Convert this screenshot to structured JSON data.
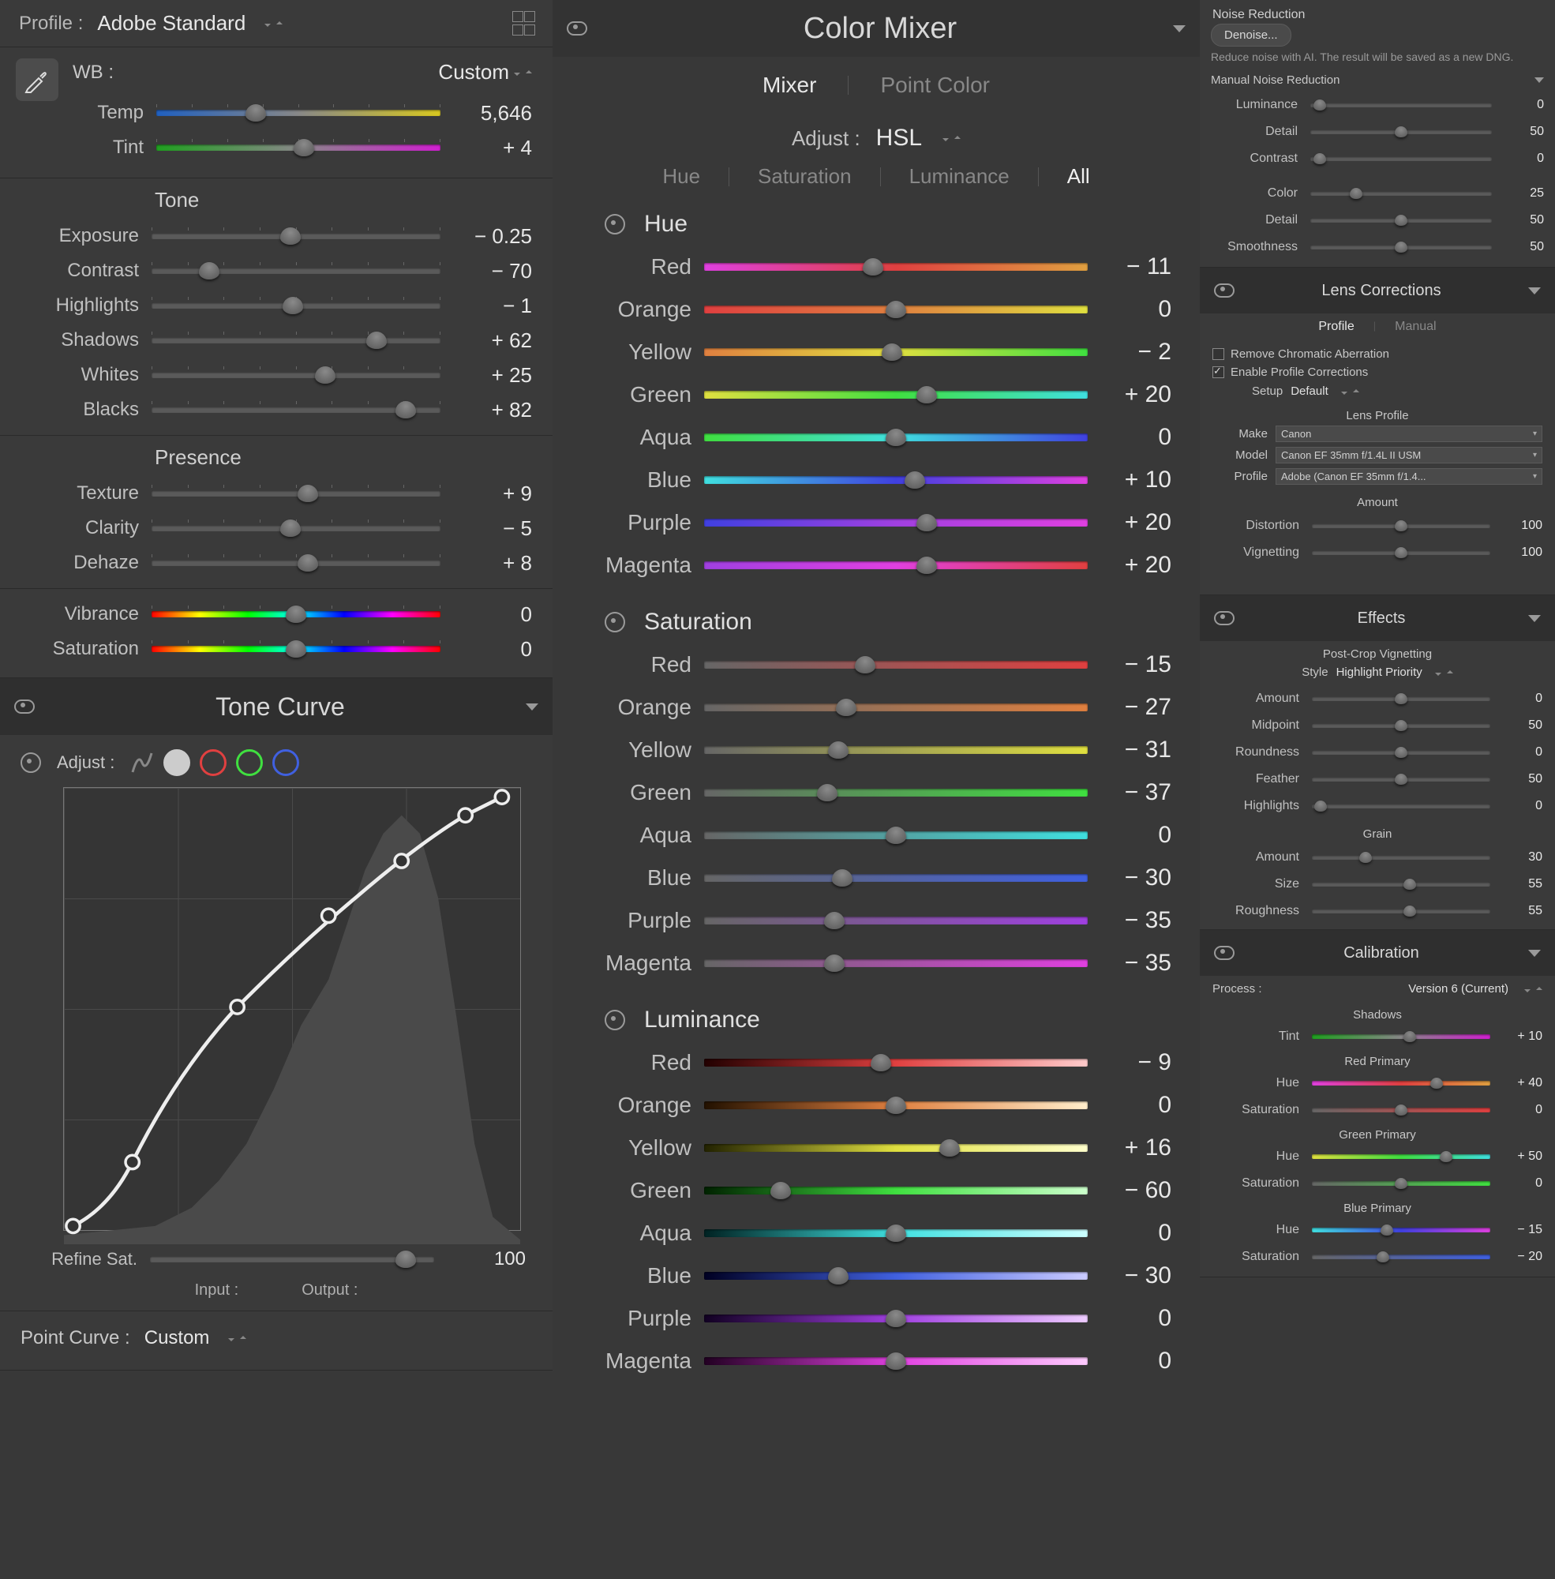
{
  "profile": {
    "label": "Profile :",
    "value": "Adobe Standard"
  },
  "basic": {
    "wb_label": "WB :",
    "wb_value": "Custom",
    "temp": {
      "label": "Temp",
      "value": "5,646",
      "pos": 35
    },
    "tint": {
      "label": "Tint",
      "value": "+ 4",
      "pos": 52
    },
    "tone_hdr": "Tone",
    "exposure": {
      "label": "Exposure",
      "value": "− 0.25",
      "pos": 48
    },
    "contrast": {
      "label": "Contrast",
      "value": "− 70",
      "pos": 20
    },
    "highlights": {
      "label": "Highlights",
      "value": "− 1",
      "pos": 49
    },
    "shadows": {
      "label": "Shadows",
      "value": "+ 62",
      "pos": 78
    },
    "whites": {
      "label": "Whites",
      "value": "+ 25",
      "pos": 60
    },
    "blacks": {
      "label": "Blacks",
      "value": "+ 82",
      "pos": 88
    },
    "presence_hdr": "Presence",
    "texture": {
      "label": "Texture",
      "value": "+ 9",
      "pos": 54
    },
    "clarity": {
      "label": "Clarity",
      "value": "− 5",
      "pos": 48
    },
    "dehaze": {
      "label": "Dehaze",
      "value": "+ 8",
      "pos": 54
    },
    "vibrance": {
      "label": "Vibrance",
      "value": "0",
      "pos": 50
    },
    "saturation": {
      "label": "Saturation",
      "value": "0",
      "pos": 50
    }
  },
  "tone_curve": {
    "title": "Tone Curve",
    "adjust": "Adjust :",
    "refine": {
      "label": "Refine Sat.",
      "value": "100",
      "pos": 90
    },
    "input": "Input :",
    "output": "Output :",
    "point_curve": "Point Curve :",
    "point_value": "Custom"
  },
  "color_mixer": {
    "title": "Color Mixer",
    "tab_mixer": "Mixer",
    "tab_point": "Point Color",
    "adjust": "Adjust :",
    "adjust_val": "HSL",
    "t_hue": "Hue",
    "t_sat": "Saturation",
    "t_lum": "Luminance",
    "t_all": "All",
    "colors": [
      "Red",
      "Orange",
      "Yellow",
      "Green",
      "Aqua",
      "Blue",
      "Purple",
      "Magenta"
    ],
    "hue": {
      "hdr": "Hue",
      "vals": [
        "− 11",
        "0",
        "− 2",
        "+ 20",
        "0",
        "+ 10",
        "+ 20",
        "+ 20"
      ],
      "pos": [
        44,
        50,
        49,
        58,
        50,
        55,
        58,
        58
      ]
    },
    "sat": {
      "hdr": "Saturation",
      "vals": [
        "− 15",
        "− 27",
        "− 31",
        "− 37",
        "0",
        "− 30",
        "− 35",
        "− 35"
      ],
      "pos": [
        42,
        37,
        35,
        32,
        50,
        36,
        34,
        34
      ]
    },
    "lum": {
      "hdr": "Luminance",
      "vals": [
        "− 9",
        "0",
        "+ 16",
        "− 60",
        "0",
        "− 30",
        "0",
        "0"
      ],
      "pos": [
        46,
        50,
        64,
        20,
        50,
        35,
        50,
        50
      ]
    }
  },
  "noise": {
    "title": "Noise Reduction",
    "btn": "Denoise...",
    "note": "Reduce noise with AI. The result will be saved as a new DNG.",
    "manual": "Manual Noise Reduction",
    "luminance": {
      "label": "Luminance",
      "value": "0",
      "pos": 5
    },
    "detail": {
      "label": "Detail",
      "value": "50",
      "pos": 50
    },
    "contrast": {
      "label": "Contrast",
      "value": "0",
      "pos": 5
    },
    "color": {
      "label": "Color",
      "value": "25",
      "pos": 25
    },
    "detail2": {
      "label": "Detail",
      "value": "50",
      "pos": 50
    },
    "smooth": {
      "label": "Smoothness",
      "value": "50",
      "pos": 50
    }
  },
  "lens": {
    "title": "Lens Corrections",
    "tab_profile": "Profile",
    "tab_manual": "Manual",
    "chk_ca": "Remove Chromatic Aberration",
    "chk_pc": "Enable Profile Corrections",
    "setup_lbl": "Setup",
    "setup_val": "Default",
    "profile_hdr": "Lens Profile",
    "make_lbl": "Make",
    "make_val": "Canon",
    "model_lbl": "Model",
    "model_val": "Canon EF 35mm f/1.4L II USM",
    "prof_lbl": "Profile",
    "prof_val": "Adobe (Canon EF 35mm f/1.4...",
    "amount_hdr": "Amount",
    "distortion": {
      "label": "Distortion",
      "value": "100",
      "pos": 50
    },
    "vignetting": {
      "label": "Vignetting",
      "value": "100",
      "pos": 50
    }
  },
  "effects": {
    "title": "Effects",
    "pcv": "Post-Crop Vignetting",
    "style_lbl": "Style",
    "style_val": "Highlight Priority",
    "amount": {
      "label": "Amount",
      "value": "0",
      "pos": 50
    },
    "midpoint": {
      "label": "Midpoint",
      "value": "50",
      "pos": 50
    },
    "roundness": {
      "label": "Roundness",
      "value": "0",
      "pos": 50
    },
    "feather": {
      "label": "Feather",
      "value": "50",
      "pos": 50
    },
    "highlights": {
      "label": "Highlights",
      "value": "0",
      "pos": 5
    },
    "grain": "Grain",
    "g_amount": {
      "label": "Amount",
      "value": "30",
      "pos": 30
    },
    "g_size": {
      "label": "Size",
      "value": "55",
      "pos": 55
    },
    "g_rough": {
      "label": "Roughness",
      "value": "55",
      "pos": 55
    }
  },
  "calibration": {
    "title": "Calibration",
    "process_lbl": "Process :",
    "process_val": "Version 6 (Current)",
    "shadows": "Shadows",
    "s_tint": {
      "label": "Tint",
      "value": "+ 10",
      "pos": 55
    },
    "red_p": "Red Primary",
    "r_hue": {
      "label": "Hue",
      "value": "+ 40",
      "pos": 70
    },
    "r_sat": {
      "label": "Saturation",
      "value": "0",
      "pos": 50
    },
    "green_p": "Green Primary",
    "g_hue": {
      "label": "Hue",
      "value": "+ 50",
      "pos": 75
    },
    "g_sat": {
      "label": "Saturation",
      "value": "0",
      "pos": 50
    },
    "blue_p": "Blue Primary",
    "b_hue": {
      "label": "Hue",
      "value": "− 15",
      "pos": 42
    },
    "b_sat": {
      "label": "Saturation",
      "value": "− 20",
      "pos": 40
    }
  }
}
